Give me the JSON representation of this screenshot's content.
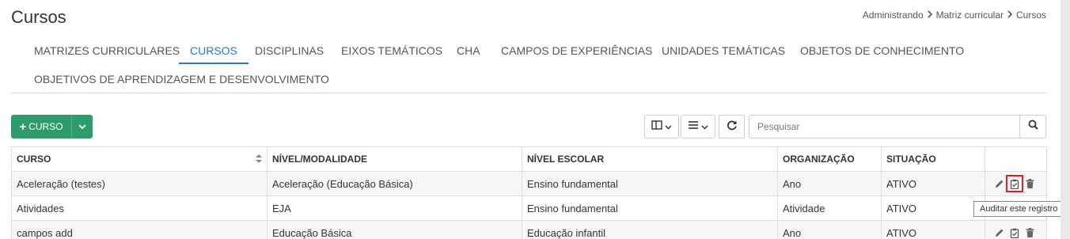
{
  "page": {
    "title": "Cursos"
  },
  "breadcrumb": [
    "Administrando",
    "Matriz curricular",
    "Cursos"
  ],
  "tabs": [
    {
      "label": "MATRIZES CURRICULARES",
      "active": false
    },
    {
      "label": "CURSOS",
      "active": true
    },
    {
      "label": "DISCIPLINAS",
      "active": false
    },
    {
      "label": "EIXOS TEMÁTICOS",
      "active": false
    },
    {
      "label": "CHA",
      "active": false
    },
    {
      "label": "CAMPOS DE EXPERIÊNCIAS",
      "active": false
    },
    {
      "label": "UNIDADES TEMÁTICAS",
      "active": false
    },
    {
      "label": "OBJETOS DE CONHECIMENTO",
      "active": false
    },
    {
      "label": "OBJETIVOS DE APRENDIZAGEM E DESENVOLVIMENTO",
      "active": false
    }
  ],
  "toolbar": {
    "add_label": "CURSO",
    "search_placeholder": "Pesquisar"
  },
  "table": {
    "columns": [
      "CURSO",
      "NÍVEL/MODALIDADE",
      "NÍVEL ESCOLAR",
      "ORGANIZAÇÃO",
      "SITUAÇÃO",
      ""
    ],
    "rows": [
      [
        "Aceleração (testes)",
        "Aceleração (Educação Básica)",
        "Ensino fundamental",
        "Ano",
        "ATIVO"
      ],
      [
        "Atividades",
        "EJA",
        "Ensino fundamental",
        "Atividade",
        "ATIVO"
      ],
      [
        "campos add",
        "Educação Básica",
        "Educação infantil",
        "Ano",
        "ATIVO"
      ]
    ]
  },
  "tooltip": {
    "text": "Auditar este registro"
  },
  "colors": {
    "accent": "#2a7ab8",
    "add_button": "#2e9b6a",
    "highlight": "#e02020"
  },
  "icons": [
    "chevron-right-icon",
    "plus-icon",
    "chevron-down-icon",
    "columns-icon",
    "list-icon",
    "refresh-icon",
    "search-icon",
    "sort-icon",
    "pencil-icon",
    "clipboard-check-icon",
    "trash-icon"
  ]
}
